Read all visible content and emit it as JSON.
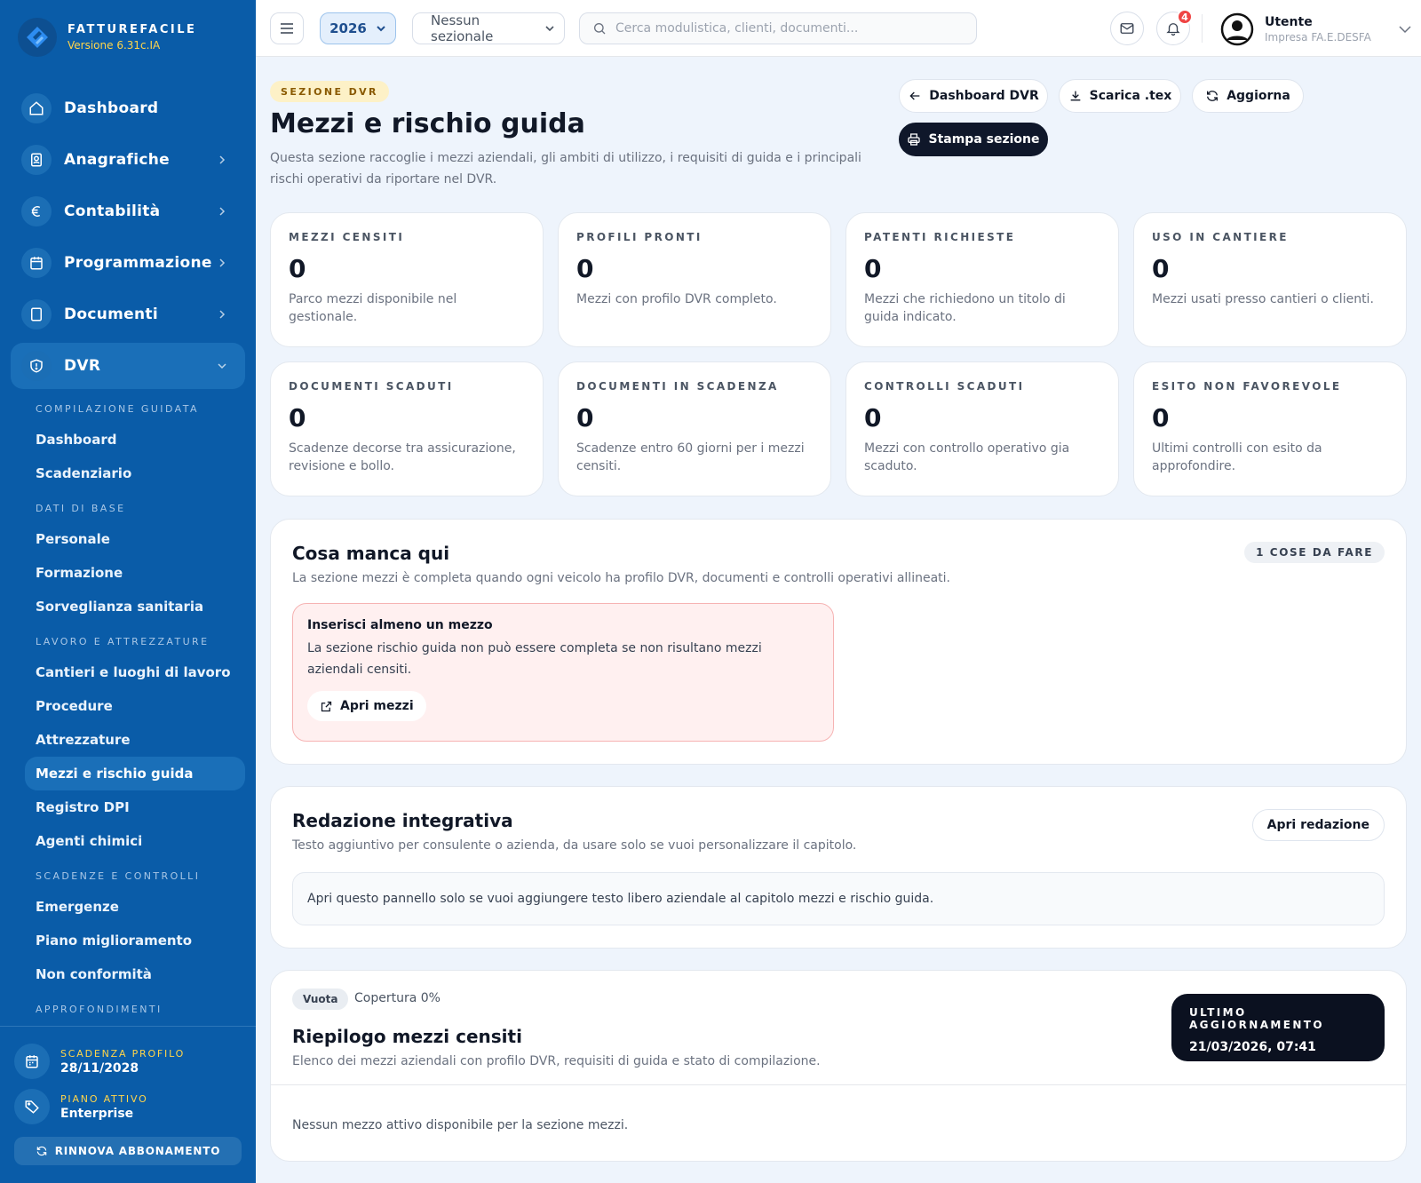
{
  "brand": {
    "name": "FATTUREFACILE",
    "version": "Versione 6.31c.IA"
  },
  "nav": [
    {
      "label": "Dashboard",
      "icon": "home-icon",
      "has_sub": false
    },
    {
      "label": "Anagrafiche",
      "icon": "contacts-icon",
      "has_sub": true
    },
    {
      "label": "Contabilità",
      "icon": "euro-icon",
      "has_sub": true
    },
    {
      "label": "Programmazione",
      "icon": "calendar-icon",
      "has_sub": true
    },
    {
      "label": "Documenti",
      "icon": "document-icon",
      "has_sub": true
    },
    {
      "label": "DVR",
      "icon": "shield-icon",
      "has_sub": true,
      "expanded": true
    }
  ],
  "dvr_menu": {
    "compilazione": {
      "heading": "COMPILAZIONE GUIDATA",
      "items": [
        "Dashboard",
        "Scadenziario"
      ]
    },
    "dati_base": {
      "heading": "DATI DI BASE",
      "items": [
        "Personale",
        "Formazione",
        "Sorveglianza sanitaria"
      ]
    },
    "lavoro": {
      "heading": "LAVORO E ATTREZZATURE",
      "items": [
        "Cantieri e luoghi di lavoro",
        "Procedure",
        "Attrezzature",
        "Mezzi e rischio guida",
        "Registro DPI",
        "Agenti chimici"
      ]
    },
    "scadenze": {
      "heading": "SCADENZE E CONTROLLI",
      "items": [
        "Emergenze",
        "Piano miglioramento",
        "Non conformità"
      ]
    },
    "approfondimenti": {
      "heading": "APPROFONDIMENTI"
    },
    "active": "Mezzi e rischio guida"
  },
  "sidebar_footer": {
    "expiry_label": "SCADENZA PROFILO",
    "expiry_value": "28/11/2028",
    "plan_label": "PIANO ATTIVO",
    "plan_value": "Enterprise",
    "renew_label": "RINNOVA ABBONAMENTO"
  },
  "topbar": {
    "year": "2026",
    "sezionale": "Nessun sezionale",
    "search_placeholder": "Cerca modulistica, clienti, documenti...",
    "notifications": "4",
    "user_name": "Utente",
    "user_company": "Impresa FA.E.DESFA"
  },
  "header": {
    "tag": "SEZIONE DVR",
    "title": "Mezzi e rischio guida",
    "subtitle": "Questa sezione raccoglie i mezzi aziendali, gli ambiti di utilizzo, i requisiti di guida e i principali rischi operativi da riportare nel DVR.",
    "buttons": {
      "dashboard": "Dashboard DVR",
      "download": "Scarica .tex",
      "refresh": "Aggiorna",
      "print": "Stampa sezione"
    }
  },
  "kpis": [
    {
      "label": "MEZZI CENSITI",
      "value": "0",
      "desc": "Parco mezzi disponibile nel gestionale."
    },
    {
      "label": "PROFILI PRONTI",
      "value": "0",
      "desc": "Mezzi con profilo DVR completo."
    },
    {
      "label": "PATENTI RICHIESTE",
      "value": "0",
      "desc": "Mezzi che richiedono un titolo di guida indicato."
    },
    {
      "label": "USO IN CANTIERE",
      "value": "0",
      "desc": "Mezzi usati presso cantieri o clienti."
    },
    {
      "label": "DOCUMENTI SCADUTI",
      "value": "0",
      "desc": "Scadenze decorse tra assicurazione, revisione e bollo."
    },
    {
      "label": "DOCUMENTI IN SCADENZA",
      "value": "0",
      "desc": "Scadenze entro 60 giorni per i mezzi censiti."
    },
    {
      "label": "CONTROLLI SCADUTI",
      "value": "0",
      "desc": "Mezzi con controllo operativo gia scaduto."
    },
    {
      "label": "ESITO NON FAVOREVOLE",
      "value": "0",
      "desc": "Ultimi controlli con esito da approfondire."
    }
  ],
  "missing": {
    "title": "Cosa manca qui",
    "subtitle": "La sezione mezzi è completa quando ogni veicolo ha profilo DVR, documenti e controlli operativi allineati.",
    "todo_badge": "1 COSE DA FARE",
    "alert_title": "Inserisci almeno un mezzo",
    "alert_text": "La sezione rischio guida non può essere completa se non risultano mezzi aziendali censiti.",
    "alert_button": "Apri mezzi"
  },
  "redazione": {
    "title": "Redazione integrativa",
    "subtitle": "Testo aggiuntivo per consulente o azienda, da usare solo se vuoi personalizzare il capitolo.",
    "button": "Apri redazione",
    "note": "Apri questo pannello solo se vuoi aggiungere testo libero aziendale al capitolo mezzi e rischio guida."
  },
  "summary": {
    "status": "Vuota",
    "coverage": "Copertura 0%",
    "title": "Riepilogo mezzi censiti",
    "subtitle": "Elenco dei mezzi aziendali con profilo DVR, requisiti di guida e stato di compilazione.",
    "last_update_label": "ULTIMO AGGIORNAMENTO",
    "last_update_value": "21/03/2026, 07:41",
    "empty": "Nessun mezzo attivo disponibile per la sezione mezzi."
  },
  "colors": {
    "sidebar": "#0a5ca8",
    "accent_yellow": "#ffd54a",
    "dark": "#0f172a",
    "alert_bg": "#fff0f0",
    "badge_red": "#ef4444"
  }
}
